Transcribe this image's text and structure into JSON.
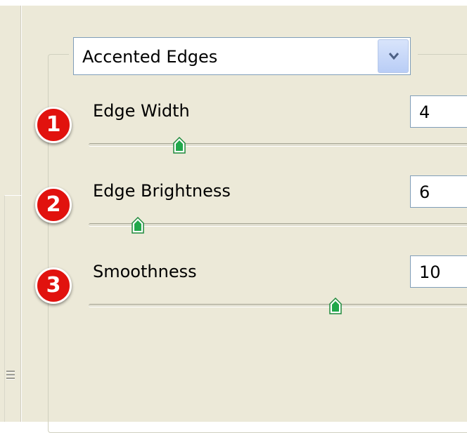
{
  "filter_select": {
    "value": "Accented Edges"
  },
  "controls": [
    {
      "badge": "1",
      "label": "Edge Width",
      "value": "4",
      "slider_fraction": 0.2
    },
    {
      "badge": "2",
      "label": "Edge Brightness",
      "value": "6",
      "slider_fraction": 0.1
    },
    {
      "badge": "3",
      "label": "Smoothness",
      "value": "10",
      "slider_fraction": 0.55
    }
  ],
  "icons": {
    "dropdown": "chevron-down-icon",
    "slider_thumb": "slider-thumb-icon",
    "grip": "resize-grip-icon"
  },
  "colors": {
    "panel_background": "#ece9d8",
    "badge_red": "#e1120e",
    "thumb_green": "#21a84b",
    "input_border": "#7f9db9"
  }
}
